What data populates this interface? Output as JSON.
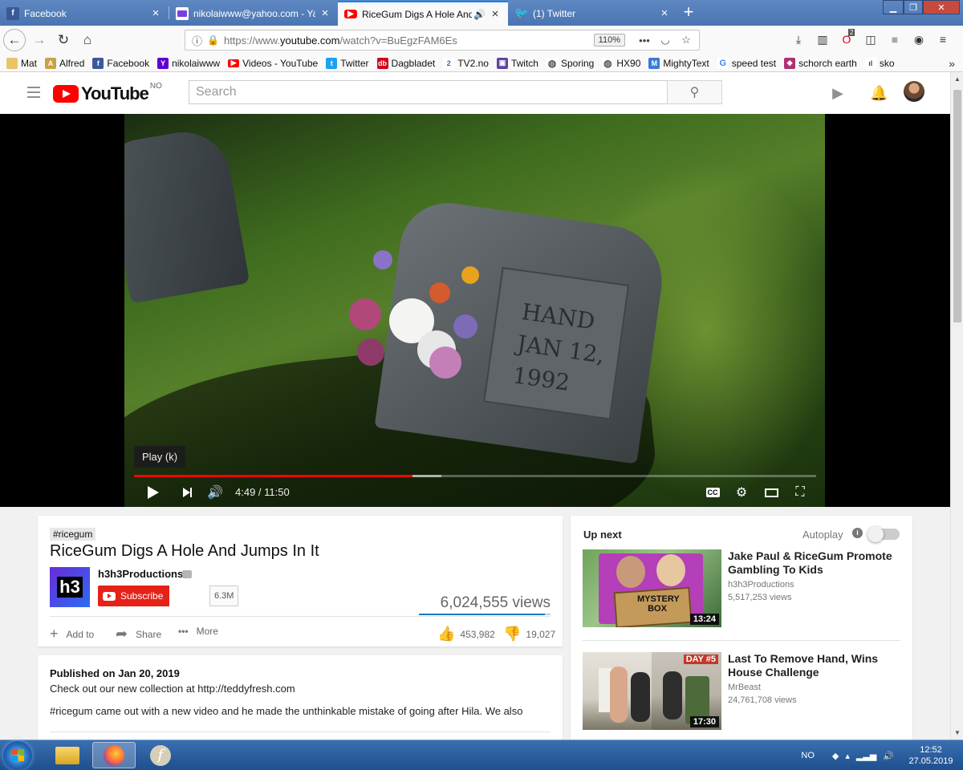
{
  "browser": {
    "tabs": [
      {
        "label": "Facebook",
        "icon": "facebook-icon",
        "active": false
      },
      {
        "label": "nikolaiwww@yahoo.com - Yah",
        "icon": "yahoo-mail-icon",
        "active": false
      },
      {
        "label": "RiceGum Digs A Hole And J",
        "icon": "youtube-icon",
        "active": true
      },
      {
        "label": "(1) Twitter",
        "icon": "twitter-icon",
        "active": false
      }
    ],
    "url_prefix": "https://www.",
    "url_domain": "youtube.com",
    "url_path": "/watch?v=BuEgzFAM6Es",
    "zoom": "110%",
    "badge_count": "2",
    "bookmarks": [
      {
        "label": "Mat",
        "icon": "folder-icon",
        "color": "#e9c46a"
      },
      {
        "label": "Alfred",
        "icon": "alfred-icon",
        "color": "#c9a14a"
      },
      {
        "label": "Facebook",
        "icon": "facebook-icon",
        "color": "#3b5998"
      },
      {
        "label": "nikolaiwww",
        "icon": "yahoo-icon",
        "color": "#5f01d1"
      },
      {
        "label": "Videos - YouTube",
        "icon": "youtube-icon",
        "color": "#ff0000"
      },
      {
        "label": "Twitter",
        "icon": "twitter-icon",
        "color": "#1da1f2"
      },
      {
        "label": "Dagbladet",
        "icon": "dagbladet-icon",
        "color": "#d0021b"
      },
      {
        "label": "TV2.no",
        "icon": "tv2-icon",
        "color": "#2b6cb0"
      },
      {
        "label": "Twitch",
        "icon": "twitch-icon",
        "color": "#6441a5"
      },
      {
        "label": "Sporing",
        "icon": "globe-icon",
        "color": "#555555"
      },
      {
        "label": "HX90",
        "icon": "globe-icon",
        "color": "#555555"
      },
      {
        "label": "MightyText",
        "icon": "mightytext-icon",
        "color": "#3a7bd5"
      },
      {
        "label": "speed test",
        "icon": "google-icon",
        "color": "#4285f4"
      },
      {
        "label": "schorch earth",
        "icon": "earth-icon",
        "color": "#b03070"
      },
      {
        "label": "sko",
        "icon": "bars-icon",
        "color": "#444444"
      }
    ]
  },
  "youtube": {
    "logo_word": "YouTube",
    "logo_country": "NO",
    "search_placeholder": "Search",
    "player": {
      "tooltip": "Play (k)",
      "time": "4:49 / 11:50",
      "played_fraction": 0.408,
      "buffered_fraction": 0.451,
      "stone_text": "HAND\nJAN 12,\n1992"
    },
    "video": {
      "hashtag": "#ricegum",
      "title": "RiceGum Digs A Hole And Jumps In It",
      "channel": "h3h3Productions",
      "channel_logo": "h3",
      "subscribe_label": "Subscribe",
      "sub_count": "6.3M",
      "views": "6,024,555 views",
      "likes": "453,982",
      "dislikes": "19,027",
      "like_fraction": 0.96,
      "add_to_label": "Add to",
      "share_label": "Share",
      "more_label": "More"
    },
    "description": {
      "published": "Published on Jan 20, 2019",
      "line1": "Check out our new collection at http://teddyfresh.com",
      "line2": "#ricegum came out with a new video and he made the unthinkable mistake of going after Hila. We also"
    },
    "up_next": {
      "title": "Up next",
      "autoplay_label": "Autoplay",
      "videos": [
        {
          "title": "Jake Paul & RiceGum Promote Gambling To Kids",
          "channel": "h3h3Productions",
          "views": "5,517,253 views",
          "duration": "13:24",
          "thumb_text": "MYSTERY BOX"
        },
        {
          "title": "Last To Remove Hand, Wins House Challenge",
          "channel": "MrBeast",
          "views": "24,761,708 views",
          "duration": "17:30",
          "thumb_text": "DAY #5"
        }
      ]
    }
  },
  "taskbar": {
    "language": "NO",
    "time": "12:52",
    "date": "27.05.2019"
  }
}
